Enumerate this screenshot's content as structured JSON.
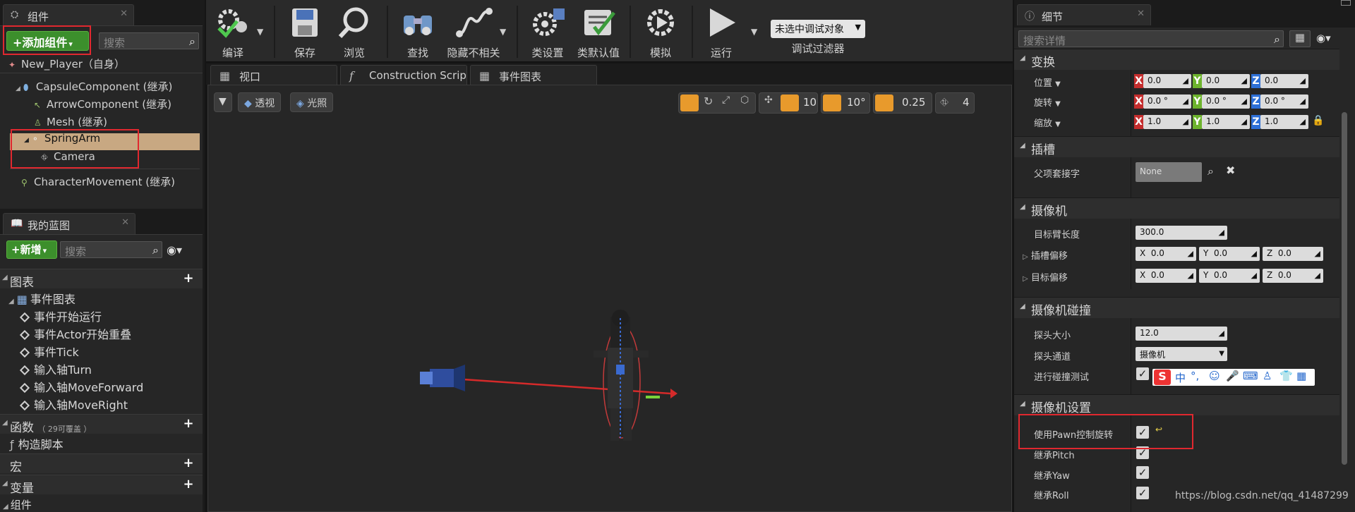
{
  "components_panel": {
    "tab_title": "组件",
    "add_button": "添加组件",
    "search_placeholder": "搜索",
    "root": "New_Player（自身）",
    "items": [
      {
        "label": "CapsuleComponent (继承)"
      },
      {
        "label": "ArrowComponent (继承)"
      },
      {
        "label": "Mesh (继承)"
      },
      {
        "label": "SpringArm"
      },
      {
        "label": "Camera"
      },
      {
        "label": "CharacterMovement (继承)"
      }
    ]
  },
  "blueprint_panel": {
    "tab_title": "我的蓝图",
    "new_button": "新增",
    "search_placeholder": "搜索",
    "graphs_header": "图表",
    "event_graph": "事件图表",
    "events": [
      "事件开始运行",
      "事件Actor开始重叠",
      "事件Tick",
      "输入轴Turn",
      "输入轴MoveForward",
      "输入轴MoveRight"
    ],
    "functions_header": "函数",
    "functions_note": "（ 29可覆盖 ）",
    "construction_script": "构造脚本",
    "macros_header": "宏",
    "variables_header": "变量",
    "components_header": "组件"
  },
  "toolbar": {
    "compile": "编译",
    "save": "保存",
    "browse": "浏览",
    "find": "查找",
    "hide_unrelated": "隐藏不相关",
    "class_settings": "类设置",
    "class_defaults": "类默认值",
    "simulate": "模拟",
    "play": "运行",
    "debug_object": "未选中调试对象",
    "debug_filter": "调试过滤器"
  },
  "viewport_tabs": [
    "视口",
    "Construction Scrip",
    "事件图表"
  ],
  "viewport": {
    "perspective": "透视",
    "lit": "光照",
    "grid_snap": "10",
    "rot_snap": "10°",
    "scale_snap": "0.25",
    "camera_speed": "4"
  },
  "details": {
    "tab_title": "细节",
    "search_placeholder": "搜索详情",
    "transform_header": "变换",
    "location_label": "位置",
    "rotation_label": "旋转",
    "scale_label": "缩放",
    "location": [
      "0.0",
      "0.0",
      "0.0"
    ],
    "rotation": [
      "0.0 °",
      "0.0 °",
      "0.0 °"
    ],
    "scale": [
      "1.0",
      "1.0",
      "1.0"
    ],
    "socket_header": "插槽",
    "parent_socket_label": "父项套接字",
    "parent_socket_value": "None",
    "camera_header": "摄像机",
    "target_arm_length_label": "目标臂长度",
    "target_arm_length": "300.0",
    "socket_offset_label": "插槽偏移",
    "socket_offset": [
      "0.0",
      "0.0",
      "0.0"
    ],
    "target_offset_label": "目标偏移",
    "target_offset": [
      "0.0",
      "0.0",
      "0.0"
    ],
    "collision_header": "摄像机碰撞",
    "probe_size_label": "探头大小",
    "probe_size": "12.0",
    "probe_channel_label": "探头通道",
    "probe_channel": "摄像机",
    "do_collision_test_label": "进行碰撞测试",
    "camera_settings_header": "摄像机设置",
    "use_pawn_control_rotation_label": "使用Pawn控制旋转",
    "inherit_pitch_label": "继承Pitch",
    "inherit_yaw_label": "继承Yaw",
    "inherit_roll_label": "继承Roll"
  },
  "ime_toolbar": {
    "chinese": "中"
  },
  "watermark": "https://blog.csdn.net/qq_41487299",
  "colors": {
    "accent_green": "#3c8f2c",
    "highlight_red": "#e0282f",
    "selection": "#c8a882"
  }
}
